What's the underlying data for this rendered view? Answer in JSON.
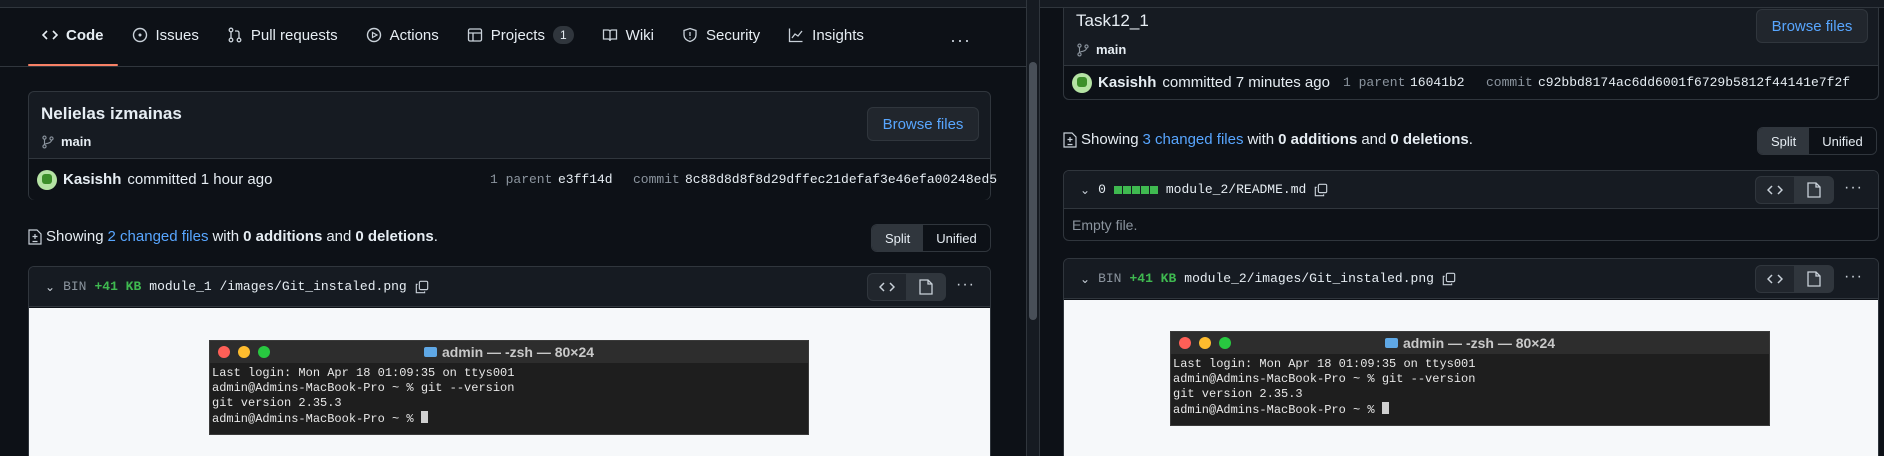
{
  "nav": {
    "items": [
      {
        "label": "Code",
        "icon": "code-icon",
        "active": true
      },
      {
        "label": "Issues",
        "icon": "issue-icon"
      },
      {
        "label": "Pull requests",
        "icon": "pull-request-icon"
      },
      {
        "label": "Actions",
        "icon": "play-icon"
      },
      {
        "label": "Projects",
        "icon": "table-icon",
        "count": "1"
      },
      {
        "label": "Wiki",
        "icon": "book-icon"
      },
      {
        "label": "Security",
        "icon": "shield-icon"
      },
      {
        "label": "Insights",
        "icon": "graph-icon"
      }
    ],
    "more": "···"
  },
  "left": {
    "commit_title": "Nelielas izmainas",
    "branch": "main",
    "browse_label": "Browse files",
    "author": "Kasishh",
    "committed_text": "committed 1 hour ago",
    "parent_label": "1 parent",
    "parent_sha": "e3ff14d",
    "commit_label": "commit",
    "commit_sha": "8c88d8d8f8d29dffec21defaf3e46efa00248ed5",
    "showing_prefix": "Showing",
    "changed_files": "2 changed files",
    "showing_mid": "with",
    "additions": "0 additions",
    "showing_and": "and",
    "deletions": "0 deletions",
    "showing_end": ".",
    "split_label": "Split",
    "unified_label": "Unified",
    "file": {
      "type": "BIN",
      "size": "+41 KB",
      "path": "module_1 /images/Git_instaled.png"
    }
  },
  "right": {
    "commit_title": "Task12_1",
    "branch": "main",
    "browse_label": "Browse files",
    "author": "Kasishh",
    "committed_text": "committed 7 minutes ago",
    "parent_label": "1 parent",
    "parent_sha": "16041b2",
    "commit_label": "commit",
    "commit_sha": "c92bbd8174ac6dd6001f6729b5812f44141e7f2f",
    "showing_prefix": "Showing",
    "changed_files": "3 changed files",
    "showing_mid": "with",
    "additions": "0 additions",
    "showing_and": "and",
    "deletions": "0 deletions",
    "showing_end": ".",
    "split_label": "Split",
    "unified_label": "Unified",
    "readme": {
      "count": "0",
      "path": "module_2/README.md",
      "empty_text": "Empty file."
    },
    "file": {
      "type": "BIN",
      "size": "+41 KB",
      "path": "module_2/images/Git_instaled.png"
    }
  },
  "terminal": {
    "title": "admin — -zsh — 80×24",
    "lines": [
      "Last login: Mon Apr 18 01:09:35 on ttys001",
      "admin@Admins-MacBook-Pro ~ % git --version",
      "git version 2.35.3",
      "admin@Admins-MacBook-Pro ~ % "
    ]
  },
  "colors": {
    "background": "#0d1117",
    "accent_blue": "#58a6ff",
    "addition_green": "#3fb950",
    "active_tab": "#f78166"
  }
}
